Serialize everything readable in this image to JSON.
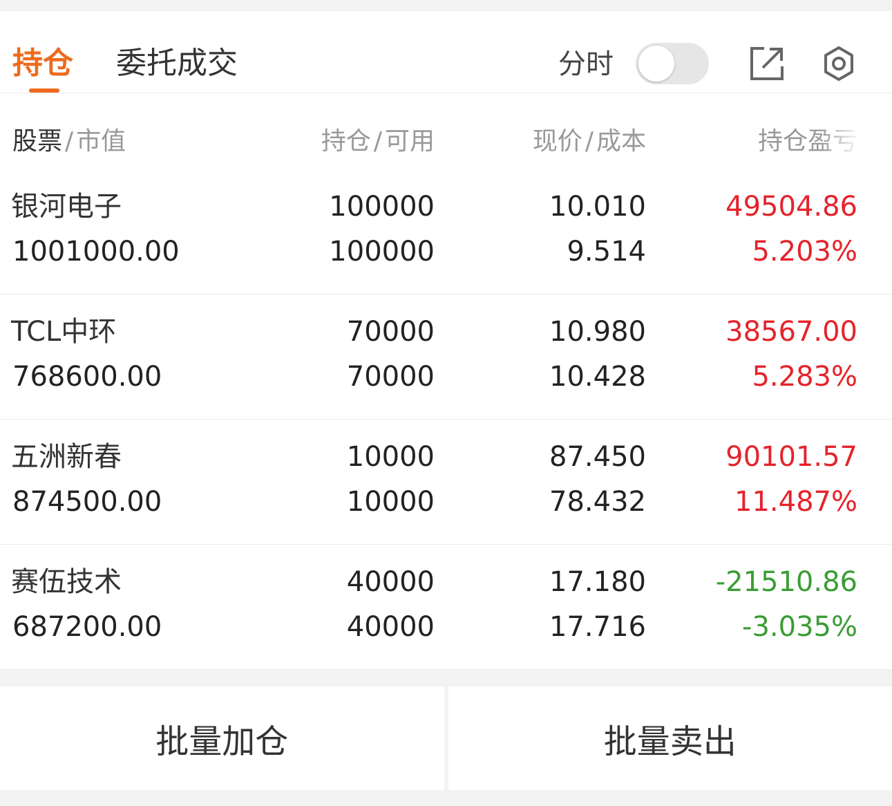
{
  "tabs": {
    "active_label": "持仓",
    "other_label": "委托成交"
  },
  "header": {
    "intraday_label": "分时",
    "intraday_toggle_on": false,
    "accent_color": "#ee6b1d"
  },
  "columns": {
    "name": "股票",
    "market_value": "市值",
    "position": "持仓",
    "available": "可用",
    "price": "现价",
    "cost": "成本",
    "pl": "持仓盈亏",
    "sep": "/"
  },
  "holdings": [
    {
      "name": "银河电子",
      "market_value": "1001000.00",
      "position": "100000",
      "available": "100000",
      "price": "10.010",
      "cost": "9.514",
      "pl": "49504.86",
      "pl_pct": "5.203%",
      "trend": "up"
    },
    {
      "name": "TCL中环",
      "market_value": "768600.00",
      "position": "70000",
      "available": "70000",
      "price": "10.980",
      "cost": "10.428",
      "pl": "38567.00",
      "pl_pct": "5.283%",
      "trend": "up"
    },
    {
      "name": "五洲新春",
      "market_value": "874500.00",
      "position": "10000",
      "available": "10000",
      "price": "87.450",
      "cost": "78.432",
      "pl": "90101.57",
      "pl_pct": "11.487%",
      "trend": "up"
    },
    {
      "name": "赛伍技术",
      "market_value": "687200.00",
      "position": "40000",
      "available": "40000",
      "price": "17.180",
      "cost": "17.716",
      "pl": "-21510.86",
      "pl_pct": "-3.035%",
      "trend": "down"
    }
  ],
  "actions": {
    "batch_add": "批量加仓",
    "batch_sell": "批量卖出"
  },
  "colors": {
    "up": "#e5232b",
    "down": "#3a9d34"
  }
}
